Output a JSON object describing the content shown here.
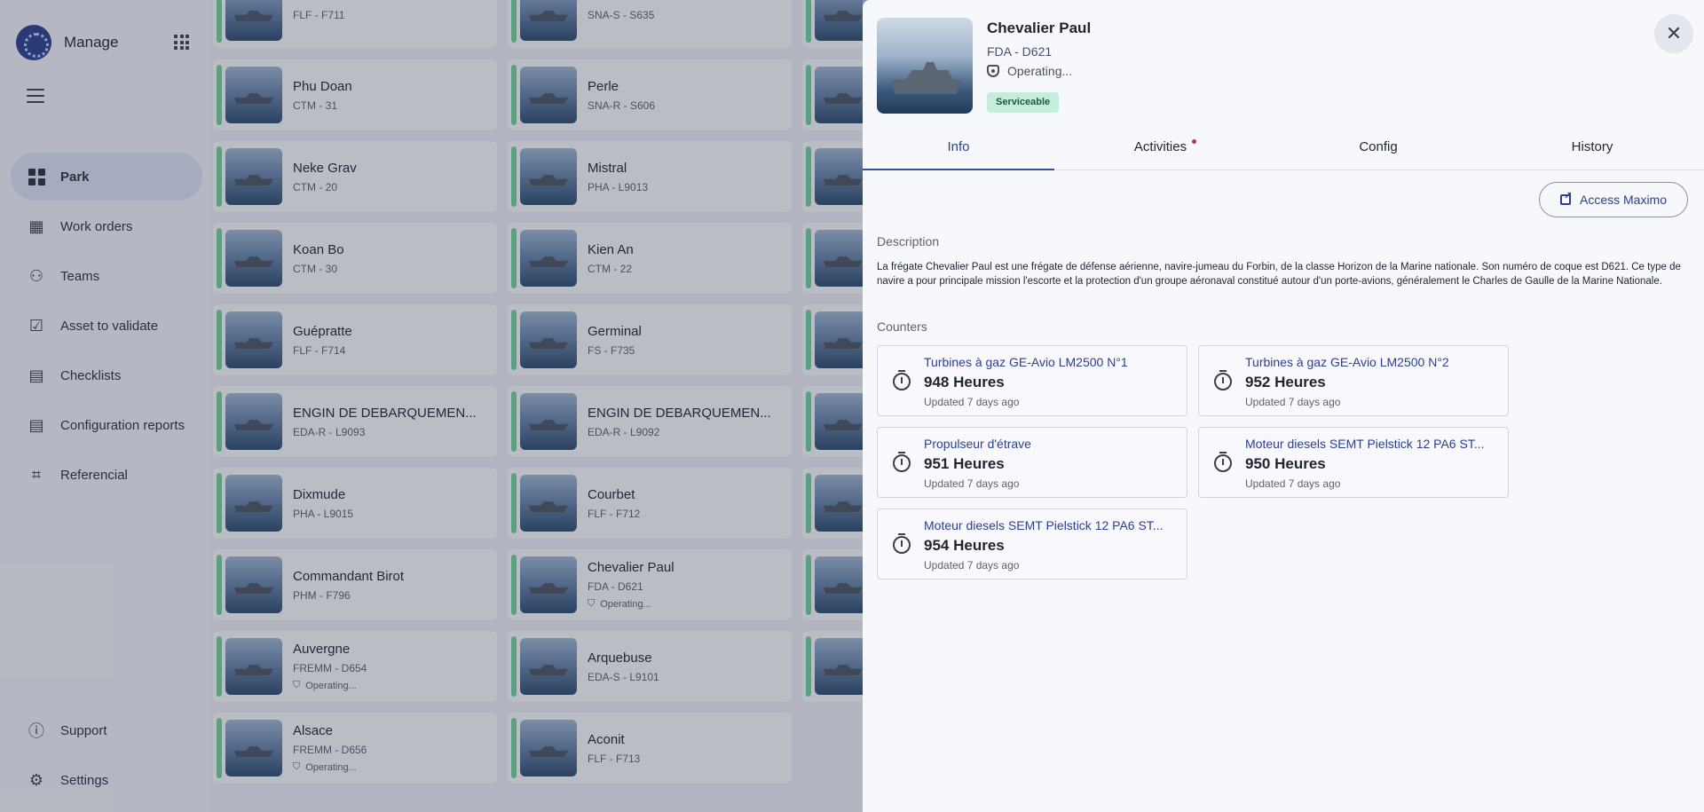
{
  "app": {
    "name": "Manage"
  },
  "sidebar": {
    "items": [
      {
        "label": "Park",
        "icon": "grid-icon",
        "active": true
      },
      {
        "label": "Work orders",
        "icon": "calendar-icon"
      },
      {
        "label": "Teams",
        "icon": "people-icon"
      },
      {
        "label": "Asset to validate",
        "icon": "hand-check-icon"
      },
      {
        "label": "Checklists",
        "icon": "checklist-icon"
      },
      {
        "label": "Configuration reports",
        "icon": "report-icon"
      },
      {
        "label": "Referencial",
        "icon": "qr-code-icon"
      }
    ],
    "bottom": [
      {
        "label": "Support",
        "icon": "help-icon"
      },
      {
        "label": "Settings",
        "icon": "gear-icon"
      }
    ]
  },
  "cards": [
    {
      "name": "",
      "code": "FLF - F711"
    },
    {
      "name": "",
      "code": "SNA-S - S635"
    },
    {
      "name": "Phu Doan",
      "code": "CTM - 31"
    },
    {
      "name": "Perle",
      "code": "SNA-R - S606"
    },
    {
      "name": "Neke Grav",
      "code": "CTM - 20"
    },
    {
      "name": "Mistral",
      "code": "PHA - L9013"
    },
    {
      "name": "Koan Bo",
      "code": "CTM - 30"
    },
    {
      "name": "Kien An",
      "code": "CTM - 22"
    },
    {
      "name": "Guépratte",
      "code": "FLF - F714"
    },
    {
      "name": "Germinal",
      "code": "FS - F735"
    },
    {
      "name": "ENGIN DE DEBARQUEMEN...",
      "code": "EDA-R - L9093"
    },
    {
      "name": "ENGIN DE DEBARQUEMEN...",
      "code": "EDA-R - L9092"
    },
    {
      "name": "Dixmude",
      "code": "PHA - L9015"
    },
    {
      "name": "Courbet",
      "code": "FLF - F712"
    },
    {
      "name": "Commandant Birot",
      "code": "PHM - F796"
    },
    {
      "name": "Chevalier Paul",
      "code": "FDA - D621",
      "status": "Operating..."
    },
    {
      "name": "Auvergne",
      "code": "FREMM - D654",
      "status": "Operating..."
    },
    {
      "name": "Arquebuse",
      "code": "EDA-S - L9101"
    },
    {
      "name": "Alsace",
      "code": "FREMM - D656",
      "status": "Operating..."
    },
    {
      "name": "Aconit",
      "code": "FLF - F713"
    }
  ],
  "detail": {
    "title": "Chevalier Paul",
    "code": "FDA - D621",
    "status": "Operating...",
    "badge": "Serviceable",
    "tabs": [
      {
        "label": "Info",
        "active": true
      },
      {
        "label": "Activities",
        "has_dot": true
      },
      {
        "label": "Config"
      },
      {
        "label": "History"
      }
    ],
    "access_button": "Access Maximo",
    "description_label": "Description",
    "description": "La frégate Chevalier Paul est une frégate de défense aérienne, navire-jumeau du Forbin, de la classe Horizon de la Marine nationale. Son numéro de coque est D621. Ce type de navire a pour principale mission l'escorte et la protection d'un groupe aéronaval constitué autour d'un porte-avions, généralement le Charles de Gaulle de la Marine Nationale.",
    "counters_label": "Counters",
    "counters": [
      {
        "name": "Turbines à gaz GE-Avio LM2500 N°1",
        "value": "948 Heures",
        "updated": "Updated 7 days ago"
      },
      {
        "name": "Turbines à gaz GE-Avio LM2500 N°2",
        "value": "952 Heures",
        "updated": "Updated 7 days ago"
      },
      {
        "name": "Propulseur d'étrave",
        "value": "951 Heures",
        "updated": "Updated 7 days ago"
      },
      {
        "name": "Moteur diesels SEMT Pielstick 12 PA6 ST...",
        "value": "950 Heures",
        "updated": "Updated 7 days ago"
      },
      {
        "name": "Moteur diesels SEMT Pielstick 12 PA6 ST...",
        "value": "954 Heures",
        "updated": "Updated 7 days ago"
      }
    ]
  }
}
